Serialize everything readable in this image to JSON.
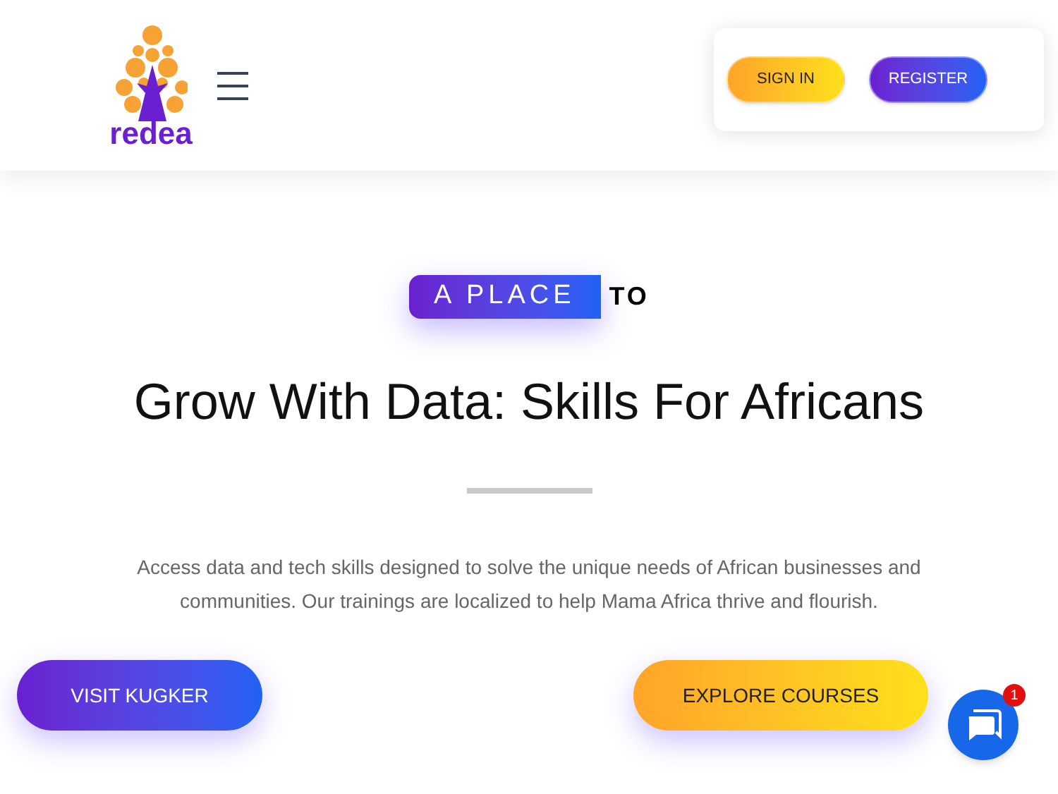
{
  "header": {
    "logo": {
      "text": "redea"
    },
    "auth_buttons": [
      {
        "label": "SIGN IN",
        "kind": "warm"
      },
      {
        "label": "REGISTER",
        "kind": "cool"
      }
    ]
  },
  "hero": {
    "tag": {
      "highlight": "A PLACE",
      "rest": "TO"
    },
    "title": "Grow With Data: Skills For Africans",
    "description": "Access data and tech skills designed to solve the unique needs of African businesses and communities. Our trainings are localized to help Mama Africa thrive and flourish.",
    "buttons": [
      {
        "label": "VISIT KUGKER",
        "kind": "cool"
      },
      {
        "label": "EXPLORE COURSES",
        "kind": "warm"
      }
    ]
  },
  "chat_widget": {
    "badge": "1"
  }
}
